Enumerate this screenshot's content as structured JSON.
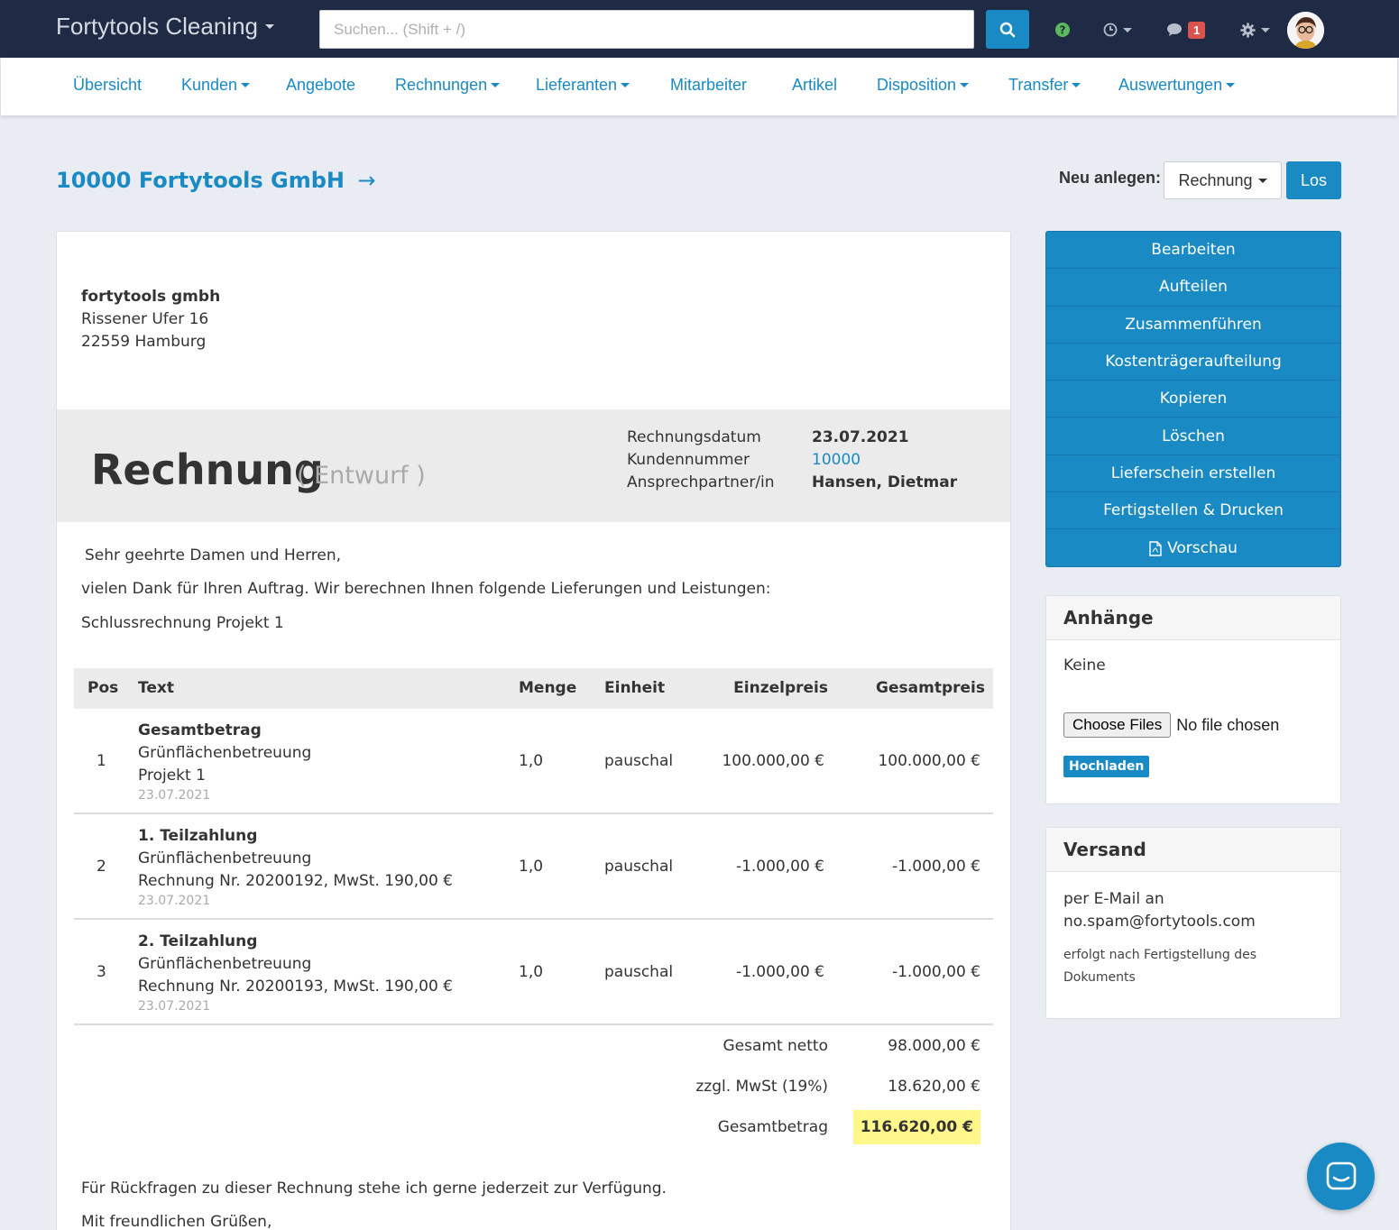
{
  "app": {
    "brand": "Fortytools Cleaning"
  },
  "search": {
    "placeholder": "Suchen... (Shift + /)",
    "value": ""
  },
  "topbar": {
    "messages_count": "1"
  },
  "nav": {
    "items": [
      {
        "label": "Übersicht",
        "dropdown": false
      },
      {
        "label": "Kunden",
        "dropdown": true
      },
      {
        "label": "Angebote",
        "dropdown": false
      },
      {
        "label": "Rechnungen",
        "dropdown": true
      },
      {
        "label": "Lieferanten",
        "dropdown": true
      },
      {
        "label": "Mitarbeiter",
        "dropdown": false
      },
      {
        "label": "Artikel",
        "dropdown": false
      },
      {
        "label": "Disposition",
        "dropdown": true
      },
      {
        "label": "Transfer",
        "dropdown": true
      },
      {
        "label": "Auswertungen",
        "dropdown": true
      }
    ]
  },
  "page": {
    "title": "10000 Fortytools GmbH",
    "title_arrow": "→",
    "new_label": "Neu anlegen:",
    "new_select": "Rechnung",
    "go_button": "Los"
  },
  "document": {
    "address": {
      "name": "fortytools gmbh",
      "street": "Rissener Ufer 16",
      "city": "22559 Hamburg"
    },
    "type": "Rechnung",
    "status": "( Entwurf )",
    "meta": [
      {
        "label": "Rechnungsdatum",
        "value": "23.07.2021"
      },
      {
        "label": "Kundennummer",
        "value": "10000"
      },
      {
        "label": "Ansprechpartner/in",
        "value": "Hansen, Dietmar"
      }
    ],
    "salutation": "Sehr geehrte Damen und Herren,",
    "intro": "vielen Dank für Ihren Auftrag. Wir berechnen Ihnen folgende Lieferungen und Leistungen:",
    "subject": "Schlussrechnung Projekt 1",
    "columns": {
      "pos": "Pos",
      "text": "Text",
      "menge": "Menge",
      "einheit": "Einheit",
      "einzelpreis": "Einzelpreis",
      "gesamtpreis": "Gesamtpreis"
    },
    "rows": [
      {
        "pos": "1",
        "title": "Gesamtbetrag",
        "line1": "Grünflächenbetreuung",
        "line2": "Projekt 1",
        "date": "23.07.2021",
        "menge": "1,0",
        "einheit": "pauschal",
        "einzelpreis": "100.000,00 €",
        "gesamtpreis": "100.000,00 €"
      },
      {
        "pos": "2",
        "title": "1. Teilzahlung",
        "line1": "Grünflächenbetreuung",
        "line2": "Rechnung Nr. 20200192, MwSt. 190,00 €",
        "date": "23.07.2021",
        "menge": "1,0",
        "einheit": "pauschal",
        "einzelpreis": "-1.000,00 €",
        "gesamtpreis": "-1.000,00 €"
      },
      {
        "pos": "3",
        "title": "2. Teilzahlung",
        "line1": "Grünflächenbetreuung",
        "line2": "Rechnung Nr. 20200193, MwSt. 190,00 €",
        "date": "23.07.2021",
        "menge": "1,0",
        "einheit": "pauschal",
        "einzelpreis": "-1.000,00 €",
        "gesamtpreis": "-1.000,00 €"
      }
    ],
    "totals": {
      "net_label": "Gesamt netto",
      "net_value": "98.000,00 €",
      "vat_label": "zzgl. MwSt (19%)",
      "vat_value": "18.620,00 €",
      "gross_label": "Gesamtbetrag",
      "gross_value": "116.620,00 €"
    },
    "closing": "Für Rückfragen zu dieser Rechnung stehe ich gerne jederzeit zur Verfügung.",
    "regards": "Mit freundlichen Grüßen,"
  },
  "actions": [
    "Bearbeiten",
    "Aufteilen",
    "Zusammenführen",
    "Kostenträgeraufteilung",
    "Kopieren",
    "Löschen",
    "Lieferschein erstellen",
    "Fertigstellen & Drucken",
    "Vorschau"
  ],
  "attachments": {
    "title": "Anhänge",
    "empty": "Keine",
    "choose_files": "Choose Files",
    "no_file": "No file chosen",
    "upload": "Hochladen"
  },
  "shipping": {
    "title": "Versand",
    "line1": "per E-Mail an",
    "email": "no.spam@fortytools.com",
    "note": "erfolgt nach Fertigstellung des Dokuments"
  },
  "colors": {
    "primary": "#1a8ac4",
    "topbar": "#1f2b44",
    "highlight": "#fff78a",
    "badge": "#d9534f"
  }
}
